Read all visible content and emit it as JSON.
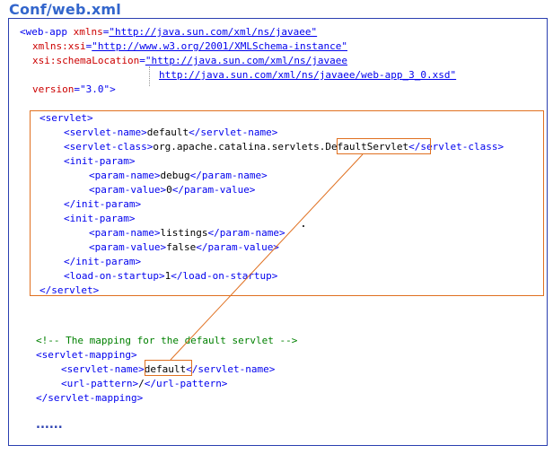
{
  "title": "Conf/web.xml",
  "colors": {
    "title": "#3366cc",
    "border": "#2a3fb0",
    "highlight": "#e07020",
    "tag": "#0000ee",
    "attribute": "#cc0000",
    "comment": "#008000"
  },
  "webapp": {
    "open": "<web-app",
    "xmlns_attr": "xmlns",
    "xmlns_val": "\"http://java.sun.com/xml/ns/javaee\"",
    "xsi_attr": "xmlns:xsi",
    "xsi_val": "\"http://www.w3.org/2001/XMLSchema-instance\"",
    "schema_attr": "xsi:schemaLocation",
    "schema_val1": "\"http://java.sun.com/xml/ns/javaee",
    "schema_val2": "http://java.sun.com/xml/ns/javaee/web-app_3_0.xsd\"",
    "version_attr": "version",
    "version_val": "\"3.0\">"
  },
  "servlet": {
    "open": "<servlet>",
    "name_open": "<servlet-name>",
    "name_val": "default",
    "name_close": "</servlet-name>",
    "class_open": "<servlet-class>",
    "class_prefix": "org.apache.catalina.servlets.",
    "class_highlight": "DefaultServlet",
    "class_close": "</servlet-class>",
    "init_open": "<init-param>",
    "init_close": "</init-param>",
    "pname_open": "<param-name>",
    "pname_close": "</param-name>",
    "pvalue_open": "<param-value>",
    "pvalue_close": "</param-value>",
    "param1_name": "debug",
    "param1_value": "0",
    "param2_name": "listings",
    "param2_value": "false",
    "los_open": "<load-on-startup>",
    "los_val": "1",
    "los_close": "</load-on-startup>",
    "close": "</servlet>"
  },
  "mapping": {
    "comment": "<!-- The mapping for the default servlet -->",
    "open": "<servlet-mapping>",
    "name_open": "<servlet-name>",
    "name_val": "default",
    "name_close": "</servlet-name>",
    "url_open": "<url-pattern>",
    "url_val": "/",
    "url_close": "</url-pattern>",
    "close": "</servlet-mapping>"
  },
  "ellipsis": "......"
}
